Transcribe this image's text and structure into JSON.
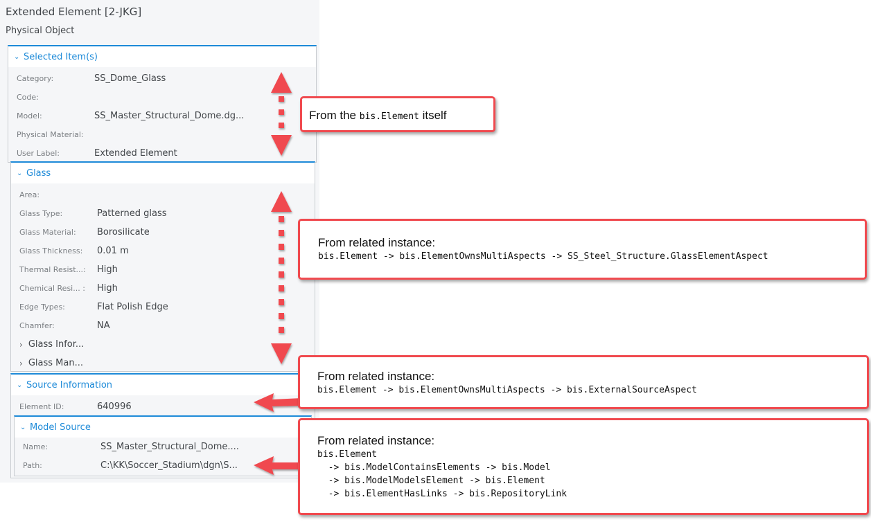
{
  "panel": {
    "title": "Extended Element [2-JKG]",
    "subtitle": "Physical Object",
    "categories": {
      "selected": {
        "label": "Selected Item(s)",
        "rows": [
          {
            "label": "Category:",
            "value": "SS_Dome_Glass"
          },
          {
            "label": "Code:",
            "value": ""
          },
          {
            "label": "Model:",
            "value": "SS_Master_Structural_Dome.dg..."
          },
          {
            "label": "Physical Material:",
            "value": ""
          },
          {
            "label": "User Label:",
            "value": "Extended Element"
          }
        ]
      },
      "glass": {
        "label": "Glass",
        "rows": [
          {
            "label": "Area:",
            "value": ""
          },
          {
            "label": "Glass Type:",
            "value": "Patterned glass"
          },
          {
            "label": "Glass Material:",
            "value": "Borosilicate"
          },
          {
            "label": "Glass Thickness:",
            "value": "0.01 m"
          },
          {
            "label": "Thermal Resist...:",
            "value": "High"
          },
          {
            "label": "Chemical Resi... :",
            "value": "High"
          },
          {
            "label": "Edge Types:",
            "value": "Flat Polish Edge"
          },
          {
            "label": "Chamfer:",
            "value": "NA"
          }
        ],
        "nested": [
          {
            "label": "Glass Infor..."
          },
          {
            "label": "Glass Man..."
          }
        ]
      },
      "source": {
        "label": "Source Information",
        "rows": [
          {
            "label": "Element ID:",
            "value": "640996"
          }
        ]
      },
      "model_source": {
        "label": "Model Source",
        "rows": [
          {
            "label": "Name:",
            "value": "SS_Master_Structural_Dome...."
          },
          {
            "label": "Path:",
            "value": "C:\\KK\\Soccer_Stadium\\dgn\\S..."
          }
        ]
      }
    }
  },
  "callouts": {
    "c1": {
      "prefix": "From the ",
      "code": "bis.Element",
      "suffix": " itself"
    },
    "c2": {
      "head": "From related instance:",
      "body": "bis.Element -> bis.ElementOwnsMultiAspects -> SS_Steel_Structure.GlassElementAspect"
    },
    "c3": {
      "head": "From related instance:",
      "body": "bis.Element -> bis.ElementOwnsMultiAspects -> bis.ExternalSourceAspect"
    },
    "c4": {
      "head": "From related instance:",
      "body": "bis.Element\n  -> bis.ModelContainsElements -> bis.Model\n  -> bis.ModelModelsElement -> bis.Element\n  -> bis.ElementHasLinks -> bis.RepositoryLink"
    }
  },
  "colors": {
    "accent": "#1d8ad8",
    "annotation": "#f04a4f"
  }
}
